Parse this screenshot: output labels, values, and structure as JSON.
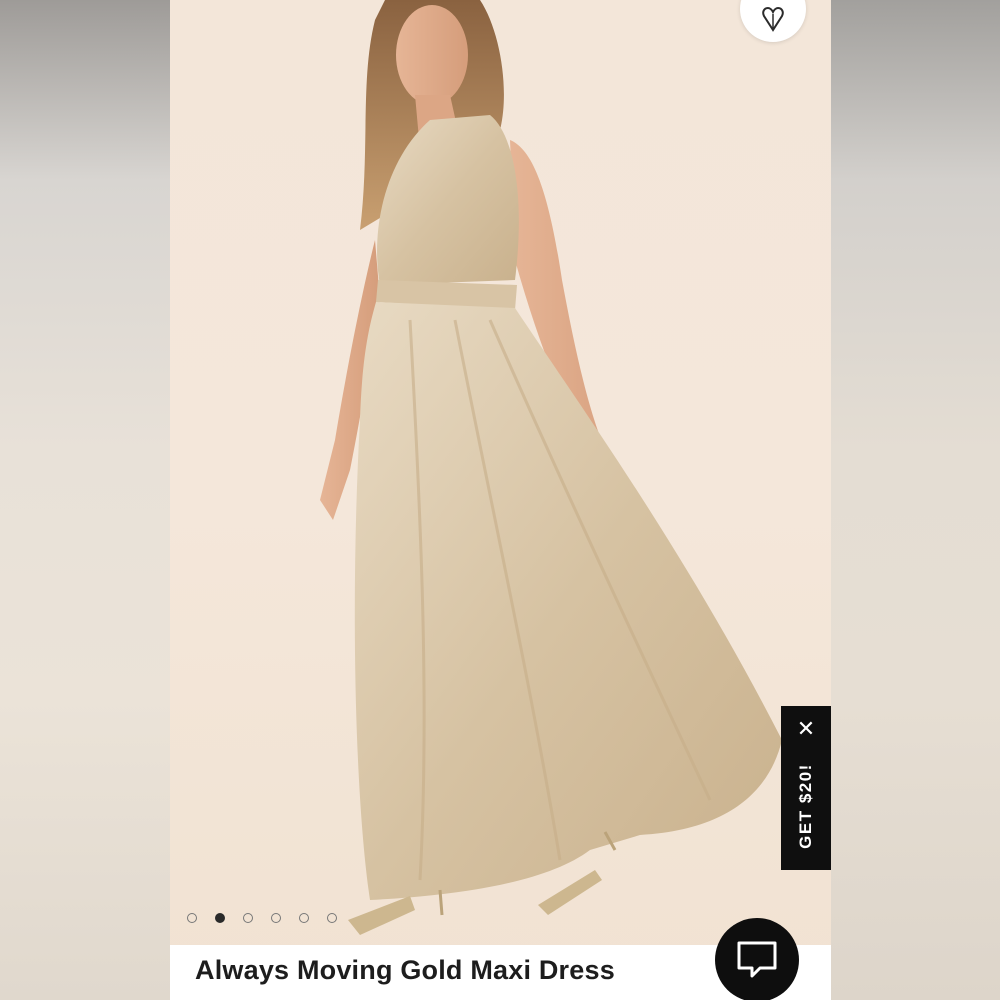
{
  "product": {
    "title": "Always Moving Gold Maxi Dress",
    "image_count": 6,
    "active_image_index": 1
  },
  "promo": {
    "label": "GET $20!",
    "close_icon": "close-icon"
  },
  "icons": {
    "favorite": "heart-leaf-icon",
    "chat": "chat-bubble-icon"
  },
  "colors": {
    "backdrop": "#f3e6d9",
    "dress": "#d9c6a8",
    "promo_bg": "#0f0f0f",
    "chat_bg": "#0e0e0e",
    "title_text": "#1d1d1d"
  }
}
